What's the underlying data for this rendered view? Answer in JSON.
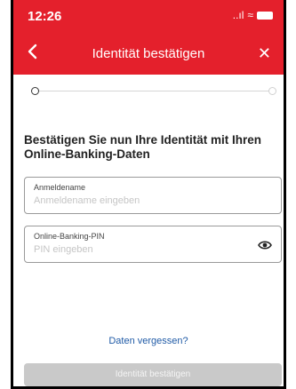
{
  "status_bar": {
    "time": "12:26",
    "signal": "..ıl",
    "wifi": "≈"
  },
  "header": {
    "title": "Identität bestätigen",
    "back_icon": "chevron-left-icon",
    "close_icon": "close-icon",
    "close_glyph": "✕"
  },
  "colors": {
    "brand": "#e4202c",
    "link": "#1f5aa6",
    "button_disabled": "#c9c9c9"
  },
  "progress": {
    "current_step": 1,
    "total_steps": 2
  },
  "main": {
    "heading": "Bestätigen Sie nun Ihre Identität mit Ihren Online-Banking-Daten",
    "username": {
      "label": "Anmeldename",
      "placeholder": "Anmeldename eingeben",
      "value": ""
    },
    "pin": {
      "label": "Online-Banking-PIN",
      "placeholder": "PIN eingeben",
      "value": "",
      "toggle_icon": "eye-icon"
    },
    "forgot_link": "Daten vergessen?",
    "submit_label": "Identität bestätigen"
  }
}
